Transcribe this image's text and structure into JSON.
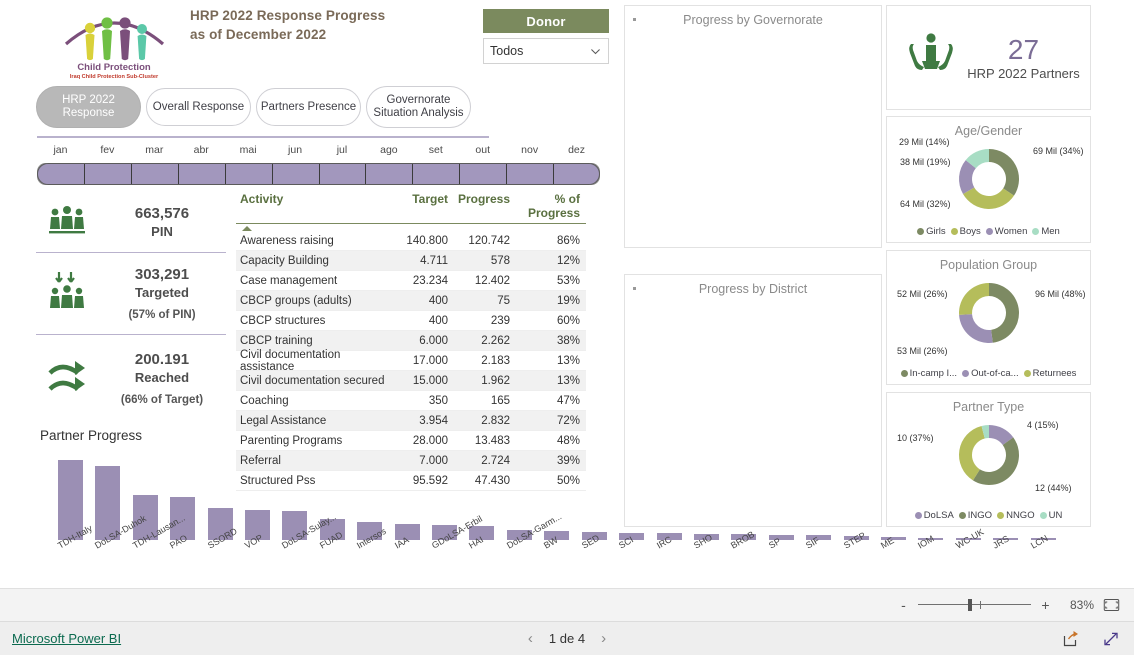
{
  "header": {
    "title_line1": "HRP 2022 Response Progress",
    "title_line2": "as of December 2022",
    "logo": {
      "name": "Child Protection",
      "subtitle": "Iraq Child Protection Sub-Cluster"
    }
  },
  "donor_slicer": {
    "title": "Donor",
    "selected": "Todos",
    "chevron_icon": "chevron-down-icon"
  },
  "nav_pills": [
    {
      "line1": "HRP 2022",
      "line2": "Response",
      "active": true
    },
    {
      "line1": "Overall Response",
      "line2": "",
      "active": false
    },
    {
      "line1": "Partners Presence",
      "line2": "",
      "active": false
    },
    {
      "line1": "Governorate",
      "line2": "Situation Analysis",
      "active": false
    }
  ],
  "timeline": {
    "months": [
      "jan",
      "fev",
      "mar",
      "abr",
      "mai",
      "jun",
      "jul",
      "ago",
      "set",
      "out",
      "nov",
      "dez"
    ]
  },
  "kpis": [
    {
      "icon": "people-group-icon",
      "number": "663,576",
      "label": "PIN",
      "sub": ""
    },
    {
      "icon": "people-targeted-icon",
      "number": "303,291",
      "label": "Targeted",
      "sub": "(57% of PIN)"
    },
    {
      "icon": "arrows-reached-icon",
      "number": "200.191",
      "label": "Reached",
      "sub": "(66% of Target)"
    }
  ],
  "activity_table": {
    "columns": [
      "Activity",
      "Target",
      "Progress",
      "% of Progress"
    ],
    "rows": [
      [
        "Awareness raising",
        "140.800",
        "120.742",
        "86%"
      ],
      [
        "Capacity Building",
        "4.711",
        "578",
        "12%"
      ],
      [
        "Case management",
        "23.234",
        "12.402",
        "53%"
      ],
      [
        "CBCP groups (adults)",
        "400",
        "75",
        "19%"
      ],
      [
        "CBCP structures",
        "400",
        "239",
        "60%"
      ],
      [
        "CBCP training",
        "6.000",
        "2.262",
        "38%"
      ],
      [
        "Civil documentation assistance",
        "17.000",
        "2.183",
        "13%"
      ],
      [
        "Civil documentation secured",
        "15.000",
        "1.962",
        "13%"
      ],
      [
        "Coaching",
        "350",
        "165",
        "47%"
      ],
      [
        "Legal Assistance",
        "3.954",
        "2.832",
        "72%"
      ],
      [
        "Parenting Programs",
        "28.000",
        "13.483",
        "48%"
      ],
      [
        "Referral",
        "7.000",
        "2.724",
        "39%"
      ],
      [
        "Structured Pss",
        "95.592",
        "47.430",
        "50%"
      ]
    ]
  },
  "partner_progress": {
    "title": "Partner Progress"
  },
  "map_panels": [
    {
      "title": "Progress by Governorate"
    },
    {
      "title": "Progress by District"
    }
  ],
  "partners_card": {
    "icon": "hands-child-icon",
    "number": "27",
    "label": "HRP 2022 Partners"
  },
  "bottom_zoom": {
    "minus": "-",
    "plus": "+",
    "percent": "83%",
    "fit_icon": "fit-to-page-icon"
  },
  "status_bar": {
    "brand": "Microsoft Power BI",
    "page_text": "1 de 4",
    "prev_icon": "chevron-left-icon",
    "next_icon": "chevron-right-icon",
    "share_icon": "share-icon",
    "fullscreen_icon": "fullscreen-icon"
  },
  "colors": {
    "donor_header": "#7b8a5e",
    "bar_purple": "#9b8fb4",
    "table_header": "#5a7040",
    "kpi_icon_green": "#3f7a42",
    "number_purple": "#7b6d96",
    "girls": "#7d8a63",
    "boys": "#b5bd5b",
    "women": "#9b8fb4",
    "men": "#a8ddc4"
  },
  "chart_data": [
    {
      "type": "bar",
      "title": "Partner Progress",
      "xlabel": "",
      "ylabel": "",
      "categories": [
        "TDH-Italy",
        "DoLSA-Duhok",
        "TDH-Lausan...",
        "PAO",
        "SSORD",
        "VOP",
        "DoLSA-Sulay...",
        "FUAD",
        "Intersos",
        "IAA",
        "GDoLSA-Erbil",
        "HAI",
        "DoLSA-Garm...",
        "BW",
        "SED",
        "SCI",
        "IRC",
        "SHO",
        "BROB",
        "SP",
        "SIF",
        "STEP",
        "ME",
        "IOM",
        "WC-UK",
        "JRS",
        "LCN"
      ],
      "values": [
        82,
        76,
        46,
        44,
        33,
        31,
        30,
        21,
        18,
        16,
        15,
        14,
        10,
        9,
        8,
        7,
        7,
        6,
        6,
        5,
        5,
        4,
        3,
        2,
        2,
        1,
        1
      ],
      "ylim": [
        0,
        90
      ],
      "grid": false
    },
    {
      "type": "pie",
      "title": "Age/Gender",
      "labels": [
        "Girls",
        "Boys",
        "Women",
        "Men"
      ],
      "values": [
        34,
        32,
        19,
        14
      ],
      "data_labels": [
        "69 Mil (34%)",
        "64 Mil (32%)",
        "38 Mil (19%)",
        "29 Mil (14%)"
      ],
      "colors": [
        "#7d8a63",
        "#b5bd5b",
        "#9b8fb4",
        "#a8ddc4"
      ],
      "legend_position": "bottom"
    },
    {
      "type": "pie",
      "title": "Population Group",
      "labels": [
        "In-camp I...",
        "Out-of-ca...",
        "Returnees"
      ],
      "values": [
        48,
        26,
        26
      ],
      "data_labels": [
        "96 Mil (48%)",
        "53 Mil (26%)",
        "52 Mil (26%)"
      ],
      "colors": [
        "#7d8a63",
        "#9b8fb4",
        "#b5bd5b"
      ],
      "legend_position": "bottom"
    },
    {
      "type": "pie",
      "title": "Partner Type",
      "labels": [
        "DoLSA",
        "INGO",
        "NNGO",
        "UN"
      ],
      "values": [
        15,
        44,
        37,
        4
      ],
      "data_labels": [
        "4 (15%)",
        "12 (44%)",
        "10 (37%)",
        ""
      ],
      "colors": [
        "#9b8fb4",
        "#7d8a63",
        "#b5bd5b",
        "#a8ddc4"
      ],
      "legend_position": "bottom"
    }
  ]
}
